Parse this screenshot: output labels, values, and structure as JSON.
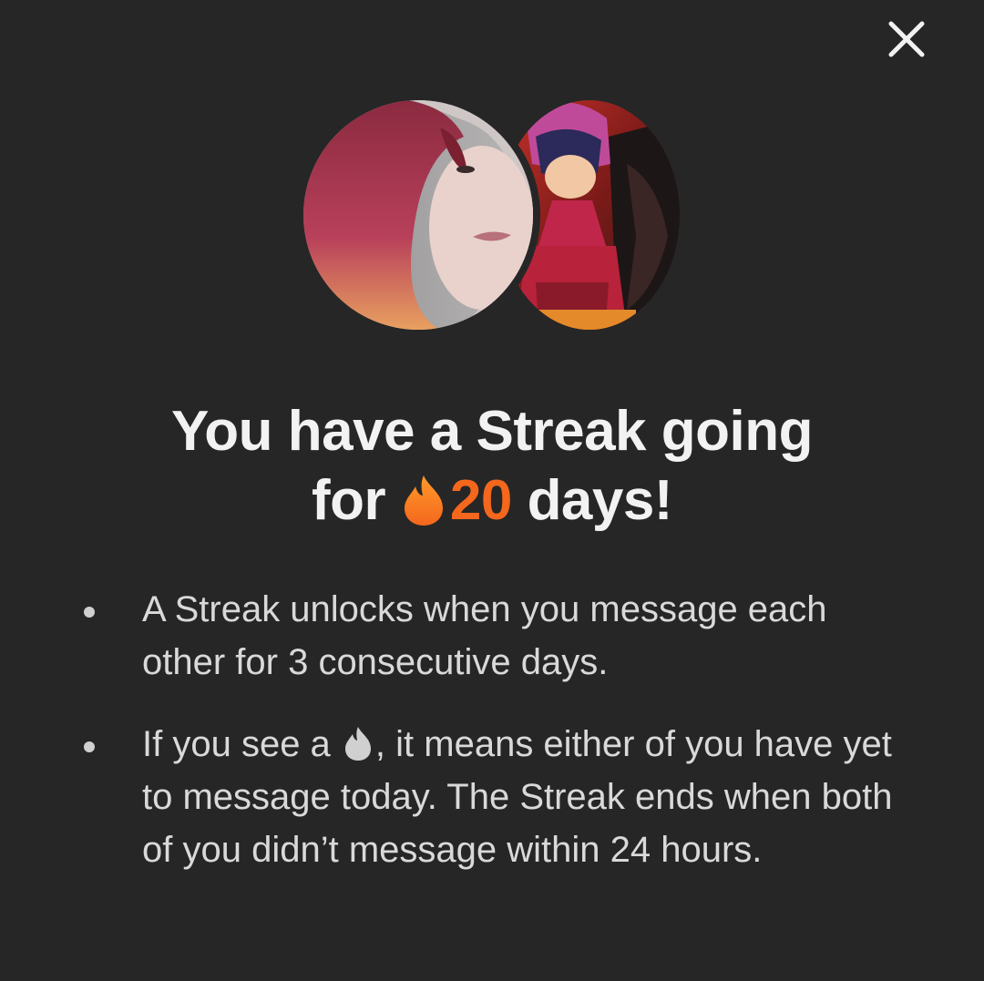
{
  "dialog": {
    "title_part1": "You have a Streak going",
    "title_part2": "for",
    "streak_count": "20",
    "title_part3": "days!",
    "bullets": [
      {
        "text": "A Streak unlocks when you message each other for 3 consecutive days."
      },
      {
        "text_before_icon": "If you see a",
        "text_after_icon": ", it means either of you have yet to message today. The Streak ends when both of you didn’t message within 24 hours."
      }
    ]
  },
  "icons": {
    "close": "close-icon",
    "streak_flame": "flame-icon",
    "pending_flame": "grey-flame-icon"
  },
  "colors": {
    "background": "#262626",
    "title": "#f2f2f2",
    "body_text": "#d9d9d9",
    "streak_accent": "#f4671d",
    "pending_flame": "#d0d0d0"
  }
}
